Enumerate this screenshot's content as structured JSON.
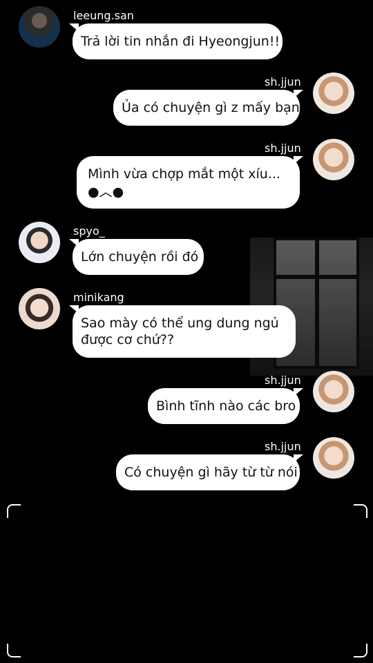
{
  "messages": [
    {
      "user": "leeung.san",
      "text": "Trả lời tin nhắn đi Hyeongjun!!",
      "side": "left"
    },
    {
      "user": "sh.jjun",
      "text": "Ủa có chuyện gì z mấy bạn",
      "side": "right"
    },
    {
      "user": "sh.jjun",
      "line1": "Mình vừa chợp mắt một xíu...",
      "line2": "●︿●",
      "side": "right"
    },
    {
      "user": "spyo_",
      "text": "Lớn chuyện rồi đó",
      "side": "left"
    },
    {
      "user": "minikang",
      "line1": "Sao mày có thể ung dung ngủ",
      "line2": "được cơ chứ??",
      "side": "left"
    },
    {
      "user": "sh.jjun",
      "text": "Bình tĩnh nào các bro",
      "side": "right"
    },
    {
      "user": "sh.jjun",
      "text": "Có chuyện gì hãy từ từ nói",
      "side": "right"
    }
  ],
  "colors": {
    "background": "#000000",
    "bubble": "#ffffff",
    "text": "#111111",
    "username": "#ffffff"
  }
}
